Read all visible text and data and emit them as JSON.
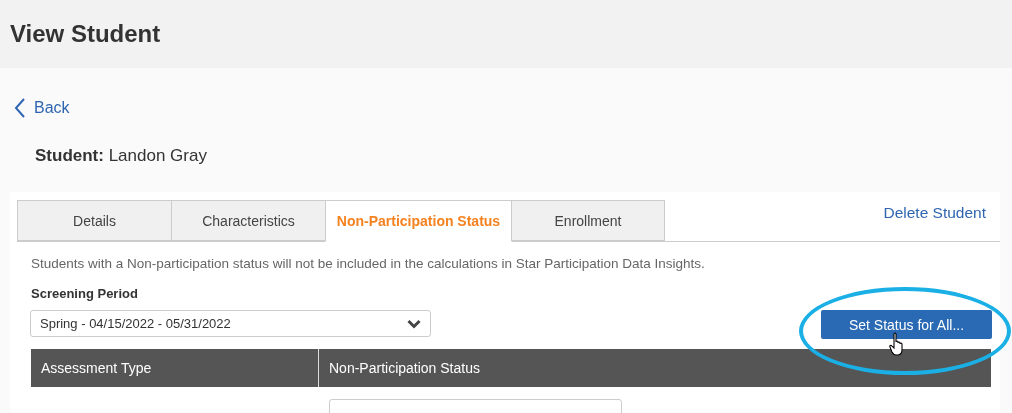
{
  "page": {
    "title": "View Student"
  },
  "back_link": "Back",
  "student": "**Student:** Landon Gray",
  "tabs": [
    {
      "label": "Details",
      "selected": false
    },
    {
      "label": "Characteristics",
      "selected": false
    },
    {
      "label": "Non-Participation Status",
      "selected": true
    },
    {
      "label": "Enrollment",
      "selected": false
    }
  ],
  "delete_link": "Delete Student",
  "description": "Students with a Non-participation status will not be included in the calculations in Star Participation Data Insights.",
  "screening_period": {
    "label": "Screening Period",
    "value": "Spring - 04/15/2022 - 05/31/2022"
  },
  "set_status_button": "Set Status for All...",
  "table": {
    "columns": [
      "Assessment Type",
      "Non-Participation Status"
    ]
  }
}
